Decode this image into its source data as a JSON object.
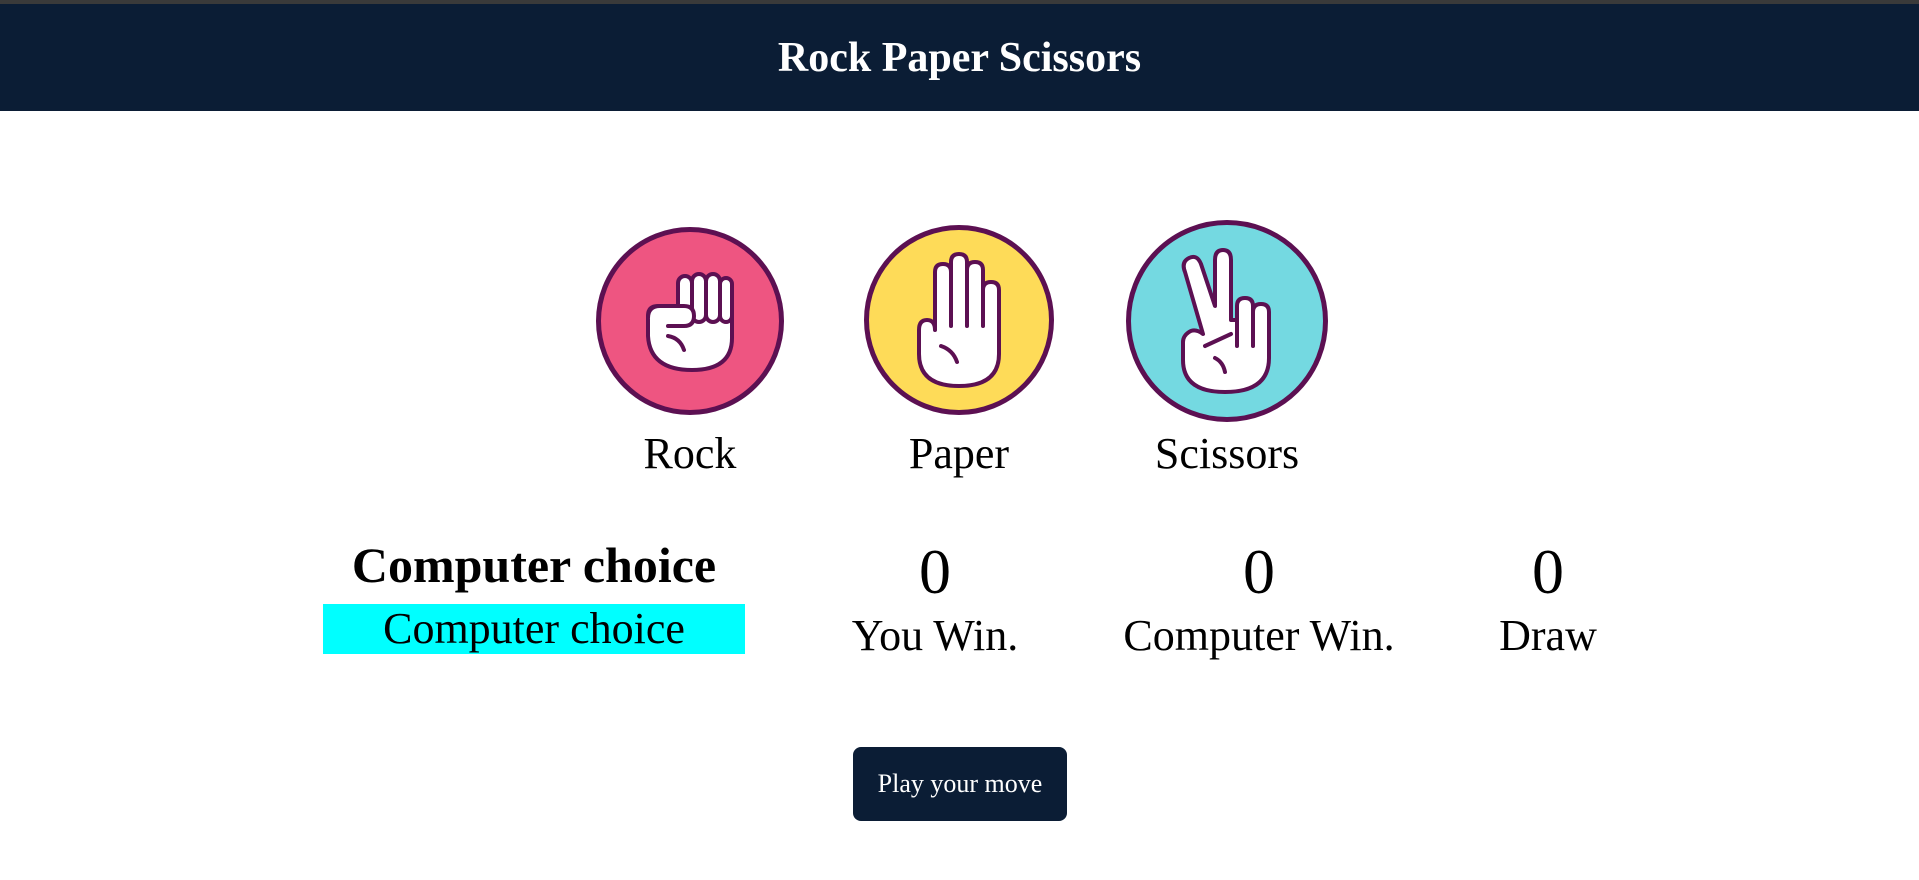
{
  "header": {
    "title": "Rock Paper Scissors"
  },
  "choices": [
    {
      "label": "Rock",
      "icon": "rock-hand-icon",
      "color": "#ee5581"
    },
    {
      "label": "Paper",
      "icon": "paper-hand-icon",
      "color": "#fedb58"
    },
    {
      "label": "Scissors",
      "icon": "scissors-hand-icon",
      "color": "#74d9e1"
    }
  ],
  "computer": {
    "title": "Computer choice",
    "value": "Computer choice",
    "highlight_color": "#00ffff"
  },
  "scores": {
    "you": {
      "value": "0",
      "label": "You Win."
    },
    "computer": {
      "value": "0",
      "label": "Computer Win."
    },
    "draw": {
      "value": "0",
      "label": "Draw"
    }
  },
  "play_button": {
    "label": "Play your move"
  },
  "colors": {
    "navy": "#0b1d35",
    "outline": "#5c1052"
  }
}
